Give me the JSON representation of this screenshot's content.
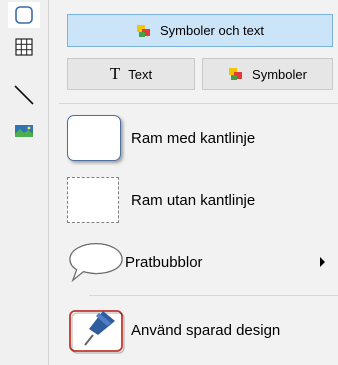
{
  "sidebar": {
    "items": [
      {
        "name": "frame-icon",
        "active": true
      },
      {
        "name": "table-icon",
        "active": false
      },
      {
        "name": "line-icon",
        "active": false
      },
      {
        "name": "picture-icon",
        "active": false
      }
    ]
  },
  "menu": {
    "top_button": {
      "label": "Symboler och text",
      "icon": "symbol-color-icon"
    },
    "text_button": {
      "glyph": "T",
      "label": "Text"
    },
    "symbol_button": {
      "label": "Symboler",
      "icon": "symbol-color-icon"
    },
    "items": [
      {
        "label": "Ram med kantlinje",
        "icon": "bordered-frame-icon"
      },
      {
        "label": "Ram utan kantlinje",
        "icon": "borderless-frame-icon"
      },
      {
        "label": "Pratbubblor",
        "icon": "speech-bubble-icon",
        "submenu": true
      },
      {
        "label": "Använd sparad design",
        "icon": "saved-design-pin-icon"
      }
    ]
  },
  "colors": {
    "accent_bg": "#cce4f7",
    "accent_border": "#7ab3e0",
    "frame_border": "#4f6f9f",
    "saved_border": "#c0392b",
    "pin_blue": "#2f5c9e"
  }
}
